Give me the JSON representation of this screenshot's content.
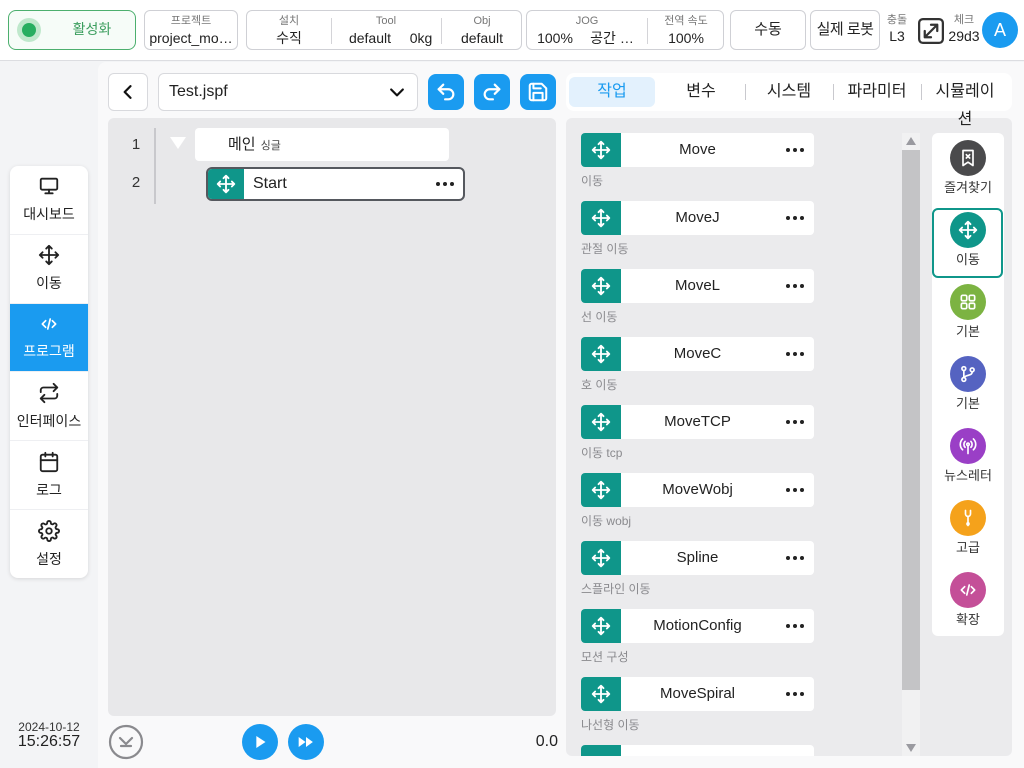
{
  "header": {
    "activate_label": "활성화",
    "project": {
      "label": "프로젝트",
      "value": "project_mo…"
    },
    "install": {
      "label": "설치",
      "value": "수직"
    },
    "tool": {
      "label": "Tool",
      "value": "default",
      "weight": "0kg"
    },
    "obj": {
      "label": "Obj",
      "value": "default"
    },
    "jog": {
      "label": "JOG",
      "value": "100%",
      "space": "공간 …"
    },
    "global_speed": {
      "label": "전역 속도",
      "value": "100%"
    },
    "mode_button": "수동",
    "robot_button": "실제 로봇",
    "collision": {
      "label": "충돌",
      "value": "L3"
    },
    "check": {
      "label": "체크",
      "value": "29d3"
    },
    "avatar_initial": "A"
  },
  "sidebar": {
    "items": [
      {
        "label": "대시보드",
        "icon": "monitor-icon"
      },
      {
        "label": "이동",
        "icon": "move-icon"
      },
      {
        "label": "프로그램",
        "icon": "code-icon",
        "active": true
      },
      {
        "label": "인터페이스",
        "icon": "swap-icon"
      },
      {
        "label": "로그",
        "icon": "calendar-icon"
      },
      {
        "label": "설정",
        "icon": "gear-icon"
      }
    ]
  },
  "datetime": {
    "date": "2024-10-12",
    "time": "15:26:57"
  },
  "editor": {
    "file_name": "Test.jspf",
    "lines": [
      {
        "number": "1",
        "label": "메인",
        "tag": "싱글"
      },
      {
        "number": "2",
        "label": "Start"
      }
    ],
    "speed_value": "0.0"
  },
  "tabs": [
    {
      "label": "작업",
      "active": true
    },
    {
      "label": "변수"
    },
    {
      "label": "시스템"
    },
    {
      "label": "파라미터"
    },
    {
      "label": "시뮬레이션"
    }
  ],
  "commands": [
    {
      "label": "Move",
      "description": "이동"
    },
    {
      "label": "MoveJ",
      "description": "관절 이동"
    },
    {
      "label": "MoveL",
      "description": "선 이동"
    },
    {
      "label": "MoveC",
      "description": "호 이동"
    },
    {
      "label": "MoveTCP",
      "description": "이동 tcp"
    },
    {
      "label": "MoveWobj",
      "description": "이동 wobj"
    },
    {
      "label": "Spline",
      "description": "스플라인 이동"
    },
    {
      "label": "MotionConfig",
      "description": "모션 구성"
    },
    {
      "label": "MoveSpiral",
      "description": "나선형 이동"
    }
  ],
  "categories": [
    {
      "label": "즐겨찾기",
      "icon": "bookmark-icon",
      "color": "#4a4a4c"
    },
    {
      "label": "이동",
      "icon": "move-icon",
      "color": "#0f968a",
      "active": true
    },
    {
      "label": "기본",
      "icon": "grid-icon",
      "color": "#7cb342"
    },
    {
      "label": "기본",
      "icon": "branch-icon",
      "color": "#5563c1"
    },
    {
      "label": "뉴스레터",
      "icon": "antenna-icon",
      "color": "#9a3fc6"
    },
    {
      "label": "고급",
      "icon": "wrench-icon",
      "color": "#f5a21b"
    },
    {
      "label": "확장",
      "icon": "code-icon",
      "color": "#c44f98"
    }
  ],
  "colors": {
    "accent": "#1a9bf0",
    "teal": "#0f968a",
    "active_green": "#27ae60"
  }
}
